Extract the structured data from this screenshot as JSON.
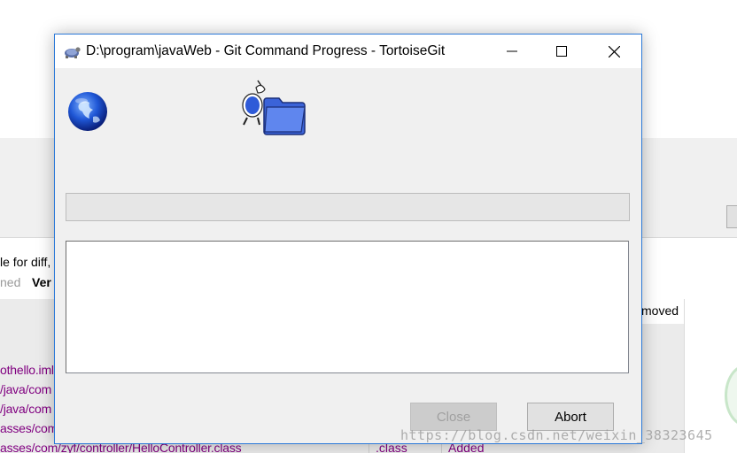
{
  "dialog": {
    "title": "D:\\program\\javaWeb - Git Command Progress - TortoiseGit",
    "progress_fraction": 0,
    "log_text": "",
    "close_label": "Close",
    "abort_label": "Abort",
    "close_enabled": false
  },
  "background": {
    "text_line1": "le for diff,",
    "text_line2_grey": "ned",
    "text_line2_bold": "Ver",
    "list_header": "moved",
    "rows": [
      "othello.iml",
      "/java/com",
      "/java/com",
      "asses/com",
      "asses/com/zyf/controller/HelloController.class"
    ],
    "last_row_ext": ".class",
    "last_row_status": "Added"
  },
  "watermark": "https://blog.csdn.net/weixin_38323645",
  "colors": {
    "accent_border": "#2b79d8",
    "progress_fill": "#06b025",
    "link_purple": "#800080"
  },
  "icons": {
    "title": "tortoisegit-icon",
    "left": "globe-icon",
    "animation": "tortoise-folder-icon",
    "minimize": "minimize-icon",
    "maximize": "maximize-icon",
    "close": "close-icon"
  }
}
